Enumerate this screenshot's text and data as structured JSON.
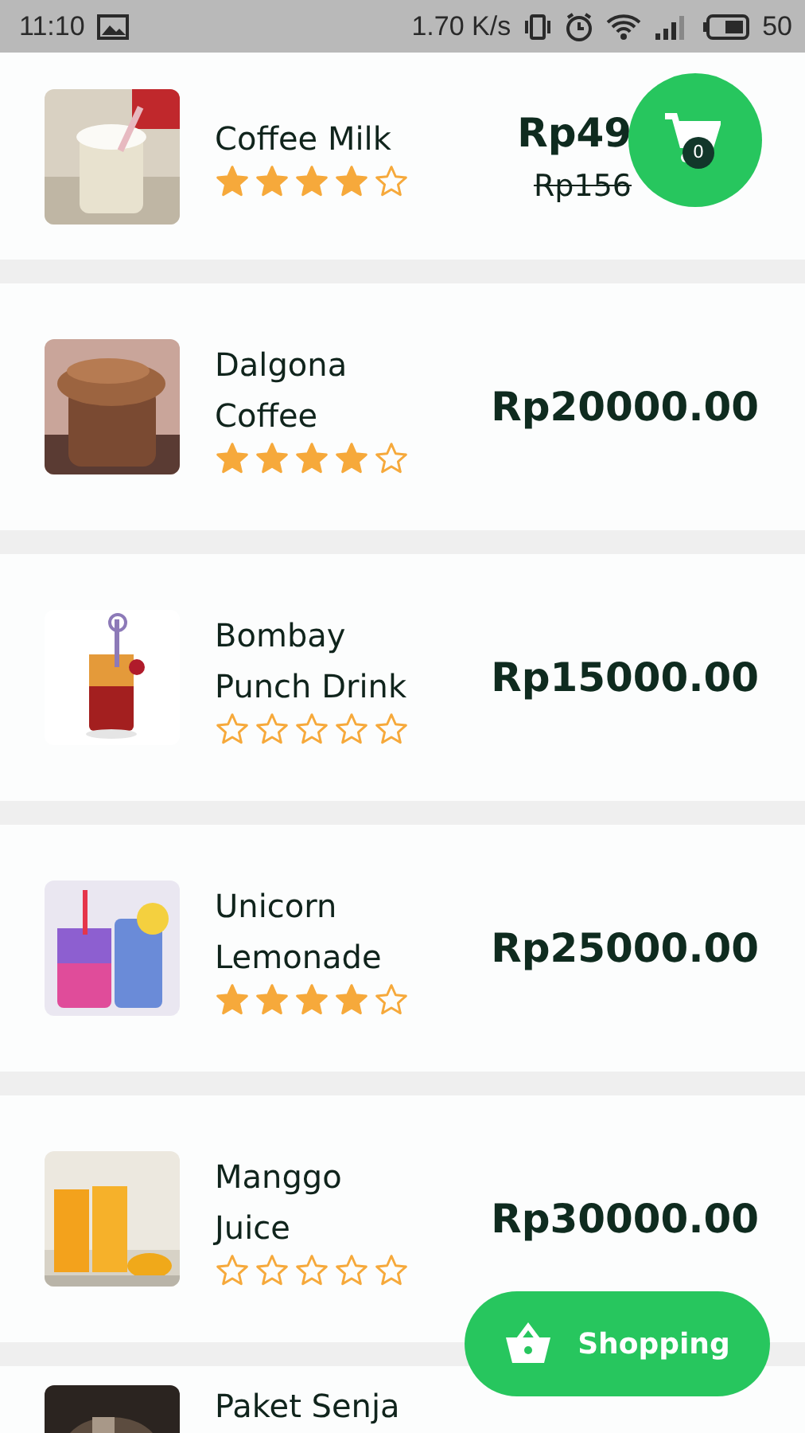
{
  "status_bar": {
    "time": "11:10",
    "speed": "1.70 K/s",
    "battery": "50"
  },
  "products": [
    {
      "name_lines": [
        "Coffee Milk"
      ],
      "stars": 4,
      "price": "Rp49",
      "old_price": "Rp156",
      "kind": "picture"
    },
    {
      "name_lines": [
        "Dalgona",
        "Coffee"
      ],
      "stars": 4,
      "price": "Rp20000.00",
      "kind": "picture"
    },
    {
      "name_lines": [
        "Bombay",
        "Punch Drink"
      ],
      "stars": 0,
      "price": "Rp15000.00",
      "kind": "picture"
    },
    {
      "name_lines": [
        "Unicorn",
        "Lemonade"
      ],
      "stars": 4,
      "price": "Rp25000.00",
      "kind": "picture"
    },
    {
      "name_lines": [
        "Manggo",
        "Juice"
      ],
      "stars": 0,
      "price": "Rp30000.00",
      "kind": "picture"
    },
    {
      "name_lines": [
        "Paket Senja"
      ],
      "kind": "picture"
    }
  ],
  "cart": {
    "count": "0"
  },
  "shopping_button": {
    "label": "Shopping"
  }
}
